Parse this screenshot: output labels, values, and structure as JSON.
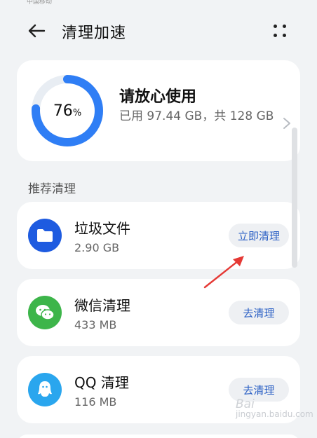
{
  "status_bar": {
    "carrier": "中国移动"
  },
  "header": {
    "title": "清理加速"
  },
  "storage": {
    "percent": "76",
    "percent_sign": "%",
    "used_fraction": 0.76,
    "title": "请放心使用",
    "detail": "已用 97.44 GB，共 128 GB"
  },
  "section": {
    "label": "推荐清理"
  },
  "items": [
    {
      "name": "垃圾文件",
      "size": "2.90 GB",
      "button": "立即清理",
      "icon": "folder-icon",
      "color": "#1e5be0"
    },
    {
      "name": "微信清理",
      "size": "433 MB",
      "button": "去清理",
      "icon": "wechat-icon",
      "color": "#3db54a"
    },
    {
      "name": "QQ 清理",
      "size": "116 MB",
      "button": "去清理",
      "icon": "qq-icon",
      "color": "#2aa6ee"
    }
  ],
  "colors": {
    "accent": "#2a5fc4",
    "ring": "#2f7ef5",
    "ring_track": "#e8edf3",
    "annotation": "#e53935"
  },
  "watermark": {
    "brand": "Bai",
    "sub": "jingyan.baidu.com"
  }
}
